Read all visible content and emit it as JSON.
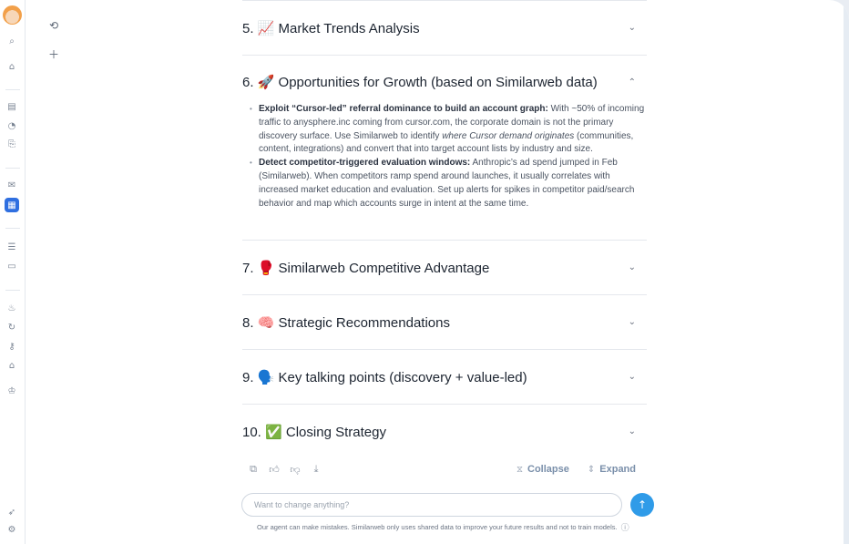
{
  "rail": {
    "icons": [
      "search-icon",
      "home-icon",
      "reports-icon",
      "analytics-icon",
      "document-search-icon",
      "inbox-icon",
      "calendar-icon",
      "list-icon",
      "table-icon",
      "fire-icon",
      "refresh-icon",
      "key-icon",
      "tag-icon",
      "crown-icon",
      "rocket-icon",
      "settings-icon"
    ],
    "accent": "#2f6fe0"
  },
  "col2": {
    "icons": [
      "history-icon",
      "plus-icon"
    ]
  },
  "sections": [
    {
      "number": "5.",
      "emoji": "📈",
      "title": "Market Trends Analysis",
      "expanded": false
    },
    {
      "number": "6.",
      "emoji": "🚀",
      "title": "Opportunities for Growth (based on Similarweb data)",
      "expanded": true,
      "bullets": [
        {
          "bold": "Exploit “Cursor-led” referral dominance to build an account graph:",
          "text1": " With ~50% of incoming traffic to anysphere.inc coming from cursor.com, the corporate domain is not the primary discovery surface. Use Similarweb to identify ",
          "italic": "where Cursor demand originates",
          "text2": " (communities, content, integrations) and convert that into target account lists by industry and size."
        },
        {
          "bold": "Detect competitor-triggered evaluation windows:",
          "text1": " Anthropic’s ad spend jumped in Feb (Similarweb). When competitors ramp spend around launches, it usually correlates with increased market education and evaluation. Set up alerts for spikes in competitor paid/search behavior and map which accounts surge in intent at the same time.",
          "italic": "",
          "text2": ""
        }
      ]
    },
    {
      "number": "7.",
      "emoji": "🥊",
      "title": "Similarweb Competitive Advantage",
      "expanded": false
    },
    {
      "number": "8.",
      "emoji": "🧠",
      "title": "Strategic Recommendations",
      "expanded": false
    },
    {
      "number": "9.",
      "emoji": "🗣️",
      "title": "Key talking points (discovery + value-led)",
      "expanded": false
    },
    {
      "number": "10.",
      "emoji": "✅",
      "title": "Closing Strategy",
      "expanded": false
    }
  ],
  "actions": {
    "collapse_label": "Collapse",
    "expand_label": "Expand"
  },
  "composer": {
    "placeholder": "Want to change anything?",
    "value": ""
  },
  "disclaimer": "Our agent can make mistakes. Similarweb only uses shared data to improve your future results and not to train models."
}
